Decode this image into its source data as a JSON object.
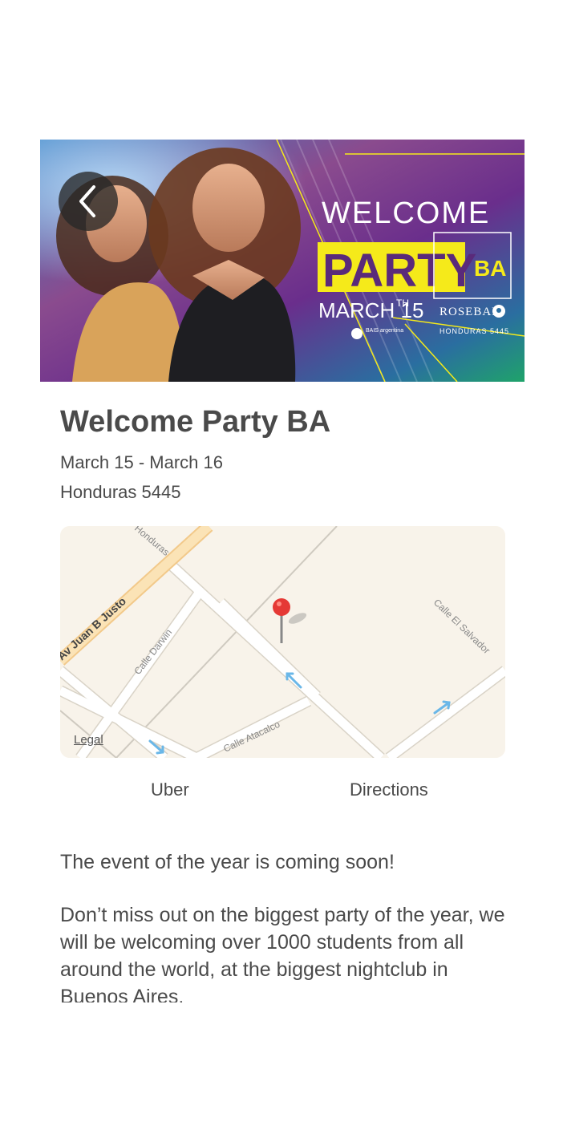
{
  "banner": {
    "welcome": "WELCOME",
    "party": "PARTY",
    "ba": "BA",
    "date": "MARCH 15",
    "date_suffix": "TH",
    "venue": "ROSEBAR",
    "venue_address": "HONDURAS 5445",
    "sponsor": "BAIS argentina"
  },
  "event": {
    "title": "Welcome Party BA",
    "dates": "March 15 - March 16",
    "address": "Honduras 5445"
  },
  "map": {
    "streets": {
      "juan_b_justo": "Av Juan B Justo",
      "honduras": "Honduras",
      "darwin": "Calle Darwin",
      "el_salvador": "Calle El Salvador",
      "atacalco": "Calle Atacalco"
    },
    "legal": "Legal"
  },
  "actions": {
    "uber": "Uber",
    "directions": "Directions"
  },
  "description": {
    "p1": "The event of the year is coming soon!",
    "p2": "Don’t miss out on the biggest party of the year, we will be welcoming over 1000 students from all around the world, at the biggest nightclub in Buenos Aires."
  },
  "colors": {
    "pin": "#e53935",
    "road": "#ffffff",
    "major_road": "#f7d9a3",
    "map_bg": "#f8f3ea",
    "banner_yellow": "#f5ea1a"
  }
}
